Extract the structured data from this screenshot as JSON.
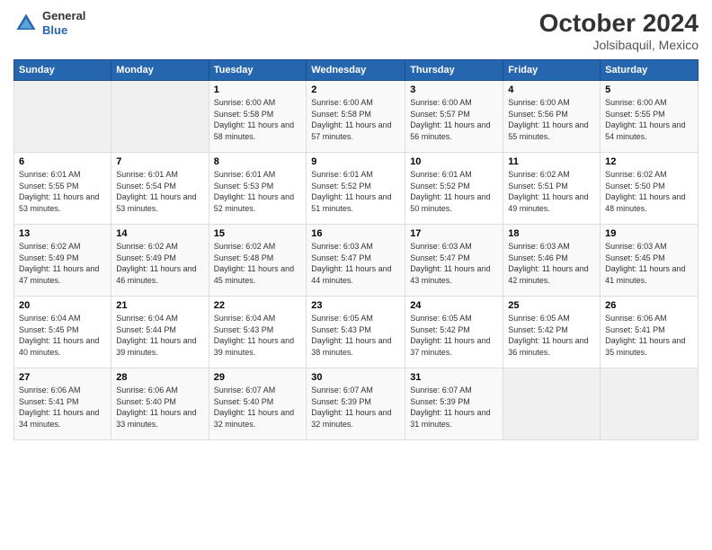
{
  "header": {
    "logo": {
      "general": "General",
      "blue": "Blue"
    },
    "title": "October 2024",
    "subtitle": "Jolsibaquil, Mexico"
  },
  "days_of_week": [
    "Sunday",
    "Monday",
    "Tuesday",
    "Wednesday",
    "Thursday",
    "Friday",
    "Saturday"
  ],
  "weeks": [
    [
      {
        "day": "",
        "info": ""
      },
      {
        "day": "",
        "info": ""
      },
      {
        "day": "1",
        "info": "Sunrise: 6:00 AM\nSunset: 5:58 PM\nDaylight: 11 hours and 58 minutes."
      },
      {
        "day": "2",
        "info": "Sunrise: 6:00 AM\nSunset: 5:58 PM\nDaylight: 11 hours and 57 minutes."
      },
      {
        "day": "3",
        "info": "Sunrise: 6:00 AM\nSunset: 5:57 PM\nDaylight: 11 hours and 56 minutes."
      },
      {
        "day": "4",
        "info": "Sunrise: 6:00 AM\nSunset: 5:56 PM\nDaylight: 11 hours and 55 minutes."
      },
      {
        "day": "5",
        "info": "Sunrise: 6:00 AM\nSunset: 5:55 PM\nDaylight: 11 hours and 54 minutes."
      }
    ],
    [
      {
        "day": "6",
        "info": "Sunrise: 6:01 AM\nSunset: 5:55 PM\nDaylight: 11 hours and 53 minutes."
      },
      {
        "day": "7",
        "info": "Sunrise: 6:01 AM\nSunset: 5:54 PM\nDaylight: 11 hours and 53 minutes."
      },
      {
        "day": "8",
        "info": "Sunrise: 6:01 AM\nSunset: 5:53 PM\nDaylight: 11 hours and 52 minutes."
      },
      {
        "day": "9",
        "info": "Sunrise: 6:01 AM\nSunset: 5:52 PM\nDaylight: 11 hours and 51 minutes."
      },
      {
        "day": "10",
        "info": "Sunrise: 6:01 AM\nSunset: 5:52 PM\nDaylight: 11 hours and 50 minutes."
      },
      {
        "day": "11",
        "info": "Sunrise: 6:02 AM\nSunset: 5:51 PM\nDaylight: 11 hours and 49 minutes."
      },
      {
        "day": "12",
        "info": "Sunrise: 6:02 AM\nSunset: 5:50 PM\nDaylight: 11 hours and 48 minutes."
      }
    ],
    [
      {
        "day": "13",
        "info": "Sunrise: 6:02 AM\nSunset: 5:49 PM\nDaylight: 11 hours and 47 minutes."
      },
      {
        "day": "14",
        "info": "Sunrise: 6:02 AM\nSunset: 5:49 PM\nDaylight: 11 hours and 46 minutes."
      },
      {
        "day": "15",
        "info": "Sunrise: 6:02 AM\nSunset: 5:48 PM\nDaylight: 11 hours and 45 minutes."
      },
      {
        "day": "16",
        "info": "Sunrise: 6:03 AM\nSunset: 5:47 PM\nDaylight: 11 hours and 44 minutes."
      },
      {
        "day": "17",
        "info": "Sunrise: 6:03 AM\nSunset: 5:47 PM\nDaylight: 11 hours and 43 minutes."
      },
      {
        "day": "18",
        "info": "Sunrise: 6:03 AM\nSunset: 5:46 PM\nDaylight: 11 hours and 42 minutes."
      },
      {
        "day": "19",
        "info": "Sunrise: 6:03 AM\nSunset: 5:45 PM\nDaylight: 11 hours and 41 minutes."
      }
    ],
    [
      {
        "day": "20",
        "info": "Sunrise: 6:04 AM\nSunset: 5:45 PM\nDaylight: 11 hours and 40 minutes."
      },
      {
        "day": "21",
        "info": "Sunrise: 6:04 AM\nSunset: 5:44 PM\nDaylight: 11 hours and 39 minutes."
      },
      {
        "day": "22",
        "info": "Sunrise: 6:04 AM\nSunset: 5:43 PM\nDaylight: 11 hours and 39 minutes."
      },
      {
        "day": "23",
        "info": "Sunrise: 6:05 AM\nSunset: 5:43 PM\nDaylight: 11 hours and 38 minutes."
      },
      {
        "day": "24",
        "info": "Sunrise: 6:05 AM\nSunset: 5:42 PM\nDaylight: 11 hours and 37 minutes."
      },
      {
        "day": "25",
        "info": "Sunrise: 6:05 AM\nSunset: 5:42 PM\nDaylight: 11 hours and 36 minutes."
      },
      {
        "day": "26",
        "info": "Sunrise: 6:06 AM\nSunset: 5:41 PM\nDaylight: 11 hours and 35 minutes."
      }
    ],
    [
      {
        "day": "27",
        "info": "Sunrise: 6:06 AM\nSunset: 5:41 PM\nDaylight: 11 hours and 34 minutes."
      },
      {
        "day": "28",
        "info": "Sunrise: 6:06 AM\nSunset: 5:40 PM\nDaylight: 11 hours and 33 minutes."
      },
      {
        "day": "29",
        "info": "Sunrise: 6:07 AM\nSunset: 5:40 PM\nDaylight: 11 hours and 32 minutes."
      },
      {
        "day": "30",
        "info": "Sunrise: 6:07 AM\nSunset: 5:39 PM\nDaylight: 11 hours and 32 minutes."
      },
      {
        "day": "31",
        "info": "Sunrise: 6:07 AM\nSunset: 5:39 PM\nDaylight: 11 hours and 31 minutes."
      },
      {
        "day": "",
        "info": ""
      },
      {
        "day": "",
        "info": ""
      }
    ]
  ]
}
